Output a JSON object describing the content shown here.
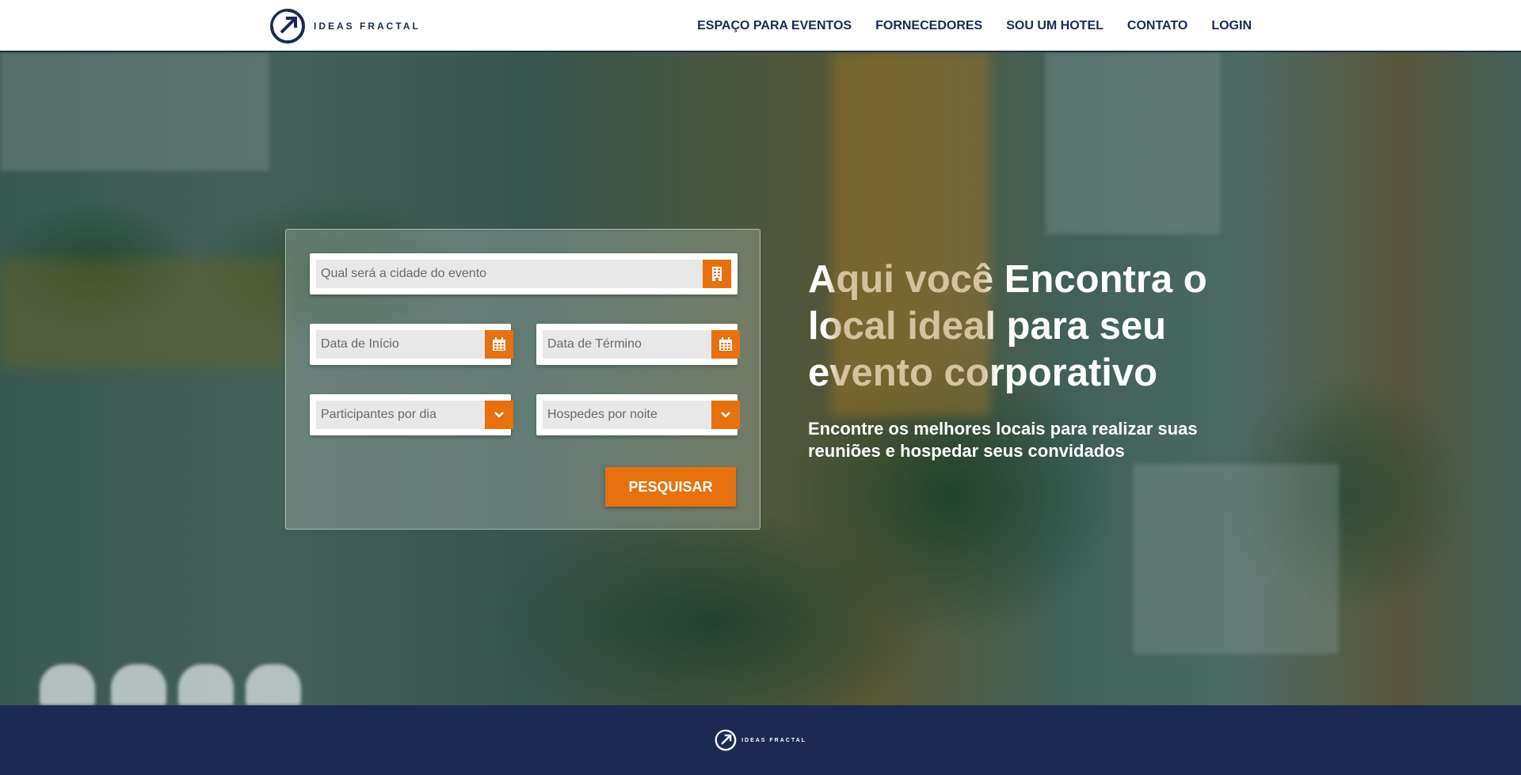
{
  "header": {
    "logo_text": "IDEAS FRACTAL",
    "nav": [
      {
        "label": "ESPAÇO PARA EVENTOS"
      },
      {
        "label": "FORNECEDORES"
      },
      {
        "label": "SOU UM HOTEL"
      },
      {
        "label": "CONTATO"
      },
      {
        "label": "LOGIN"
      }
    ]
  },
  "search": {
    "city_placeholder": "Qual será a cidade do evento",
    "start_date_placeholder": "Data de Início",
    "end_date_placeholder": "Data de Término",
    "participants_placeholder": "Participantes por dia",
    "guests_placeholder": "Hospedes por noite",
    "submit_label": "PESQUISAR"
  },
  "hero": {
    "title": "Aqui você Encontra o local ideal para seu evento corporativo",
    "subtitle": "Encontre os melhores locais para realizar suas reuniões e hospedar seus convidados"
  },
  "footer": {
    "logo_text": "IDEAS FRACTAL"
  },
  "colors": {
    "brand_navy": "#1a2a55",
    "accent_orange": "#e8710f"
  },
  "icons": {
    "logo": "arrow-circle-icon",
    "city": "building-icon",
    "date": "calendar-icon",
    "select": "chevron-down-icon"
  }
}
